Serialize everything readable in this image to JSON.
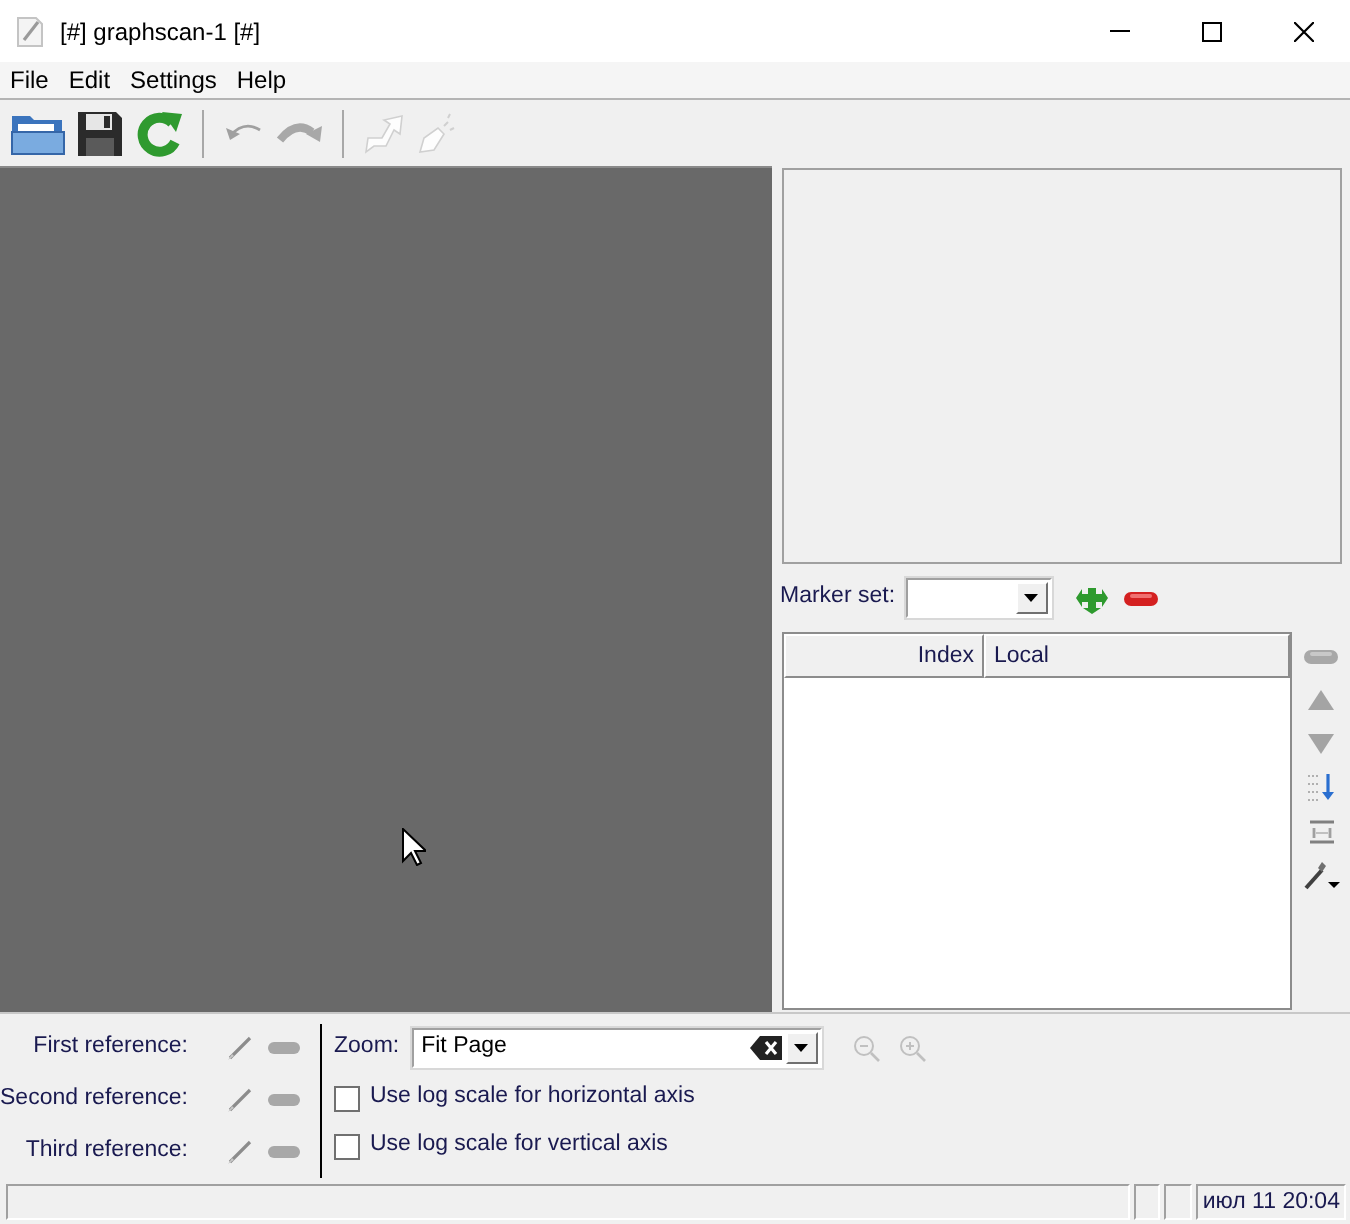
{
  "window": {
    "title": "[#] graphscan-1 [#]"
  },
  "menu": [
    "File",
    "Edit",
    "Settings",
    "Help"
  ],
  "toolbar": [
    [
      {
        "disabled": false
      },
      {
        "disabled": false
      },
      {
        "disabled": false
      }
    ],
    [
      {
        "disabled": true
      },
      {
        "disabled": true
      }
    ],
    [
      {
        "disabled": true
      },
      {
        "disabled": true
      }
    ]
  ],
  "marker_panel": {
    "label": "Marker set:",
    "table": {
      "columns": [
        "Index",
        "Local"
      ]
    }
  },
  "references": [
    {
      "label": "First reference:"
    },
    {
      "label": "Second reference:"
    },
    {
      "label": "Third reference:"
    }
  ],
  "zoom": {
    "label": "Zoom:",
    "value": "Fit Page",
    "buttons": [
      {
        "disabled": true
      },
      {
        "disabled": true
      }
    ]
  },
  "options": [
    {
      "label": "Use log scale for horizontal axis",
      "checked": false
    },
    {
      "label": "Use log scale for vertical axis",
      "checked": false
    }
  ],
  "status_bar": {
    "time": "июл 11 20:04"
  }
}
